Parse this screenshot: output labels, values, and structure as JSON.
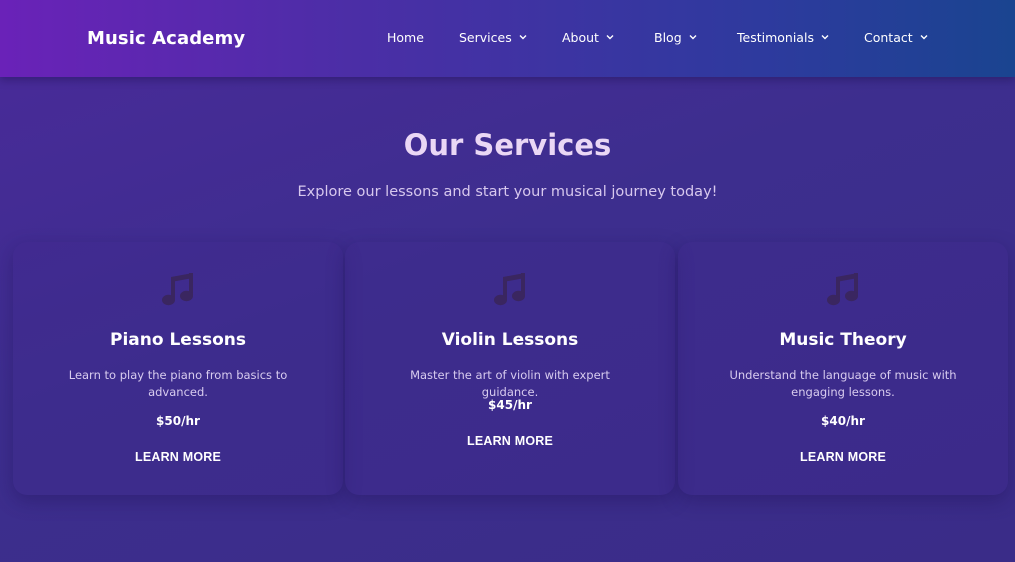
{
  "nav": {
    "brand": "Music Academy",
    "items": [
      {
        "label": "Home",
        "dropdown": false
      },
      {
        "label": "Services",
        "dropdown": true
      },
      {
        "label": "About",
        "dropdown": true
      },
      {
        "label": "Blog",
        "dropdown": true
      },
      {
        "label": "Testimonials",
        "dropdown": true
      },
      {
        "label": "Contact",
        "dropdown": true
      }
    ]
  },
  "hero": {
    "title": "Our Services",
    "subtitle": "Explore our lessons and start your musical journey today!"
  },
  "services": [
    {
      "icon": "music-note-icon",
      "title": "Piano Lessons",
      "description": "Learn to play the piano from basics to advanced.",
      "price": "$50/hr",
      "cta": "LEARN MORE"
    },
    {
      "icon": "music-note-icon",
      "title": "Violin Lessons",
      "description": "Master the art of violin with expert guidance.",
      "price": "$45/hr",
      "cta": "LEARN MORE"
    },
    {
      "icon": "music-note-icon",
      "title": "Music Theory",
      "description": "Understand the language of music with engaging lessons.",
      "price": "$40/hr",
      "cta": "LEARN MORE"
    }
  ],
  "colors": {
    "icon": "#3a2660",
    "title": "#ead7f5"
  }
}
